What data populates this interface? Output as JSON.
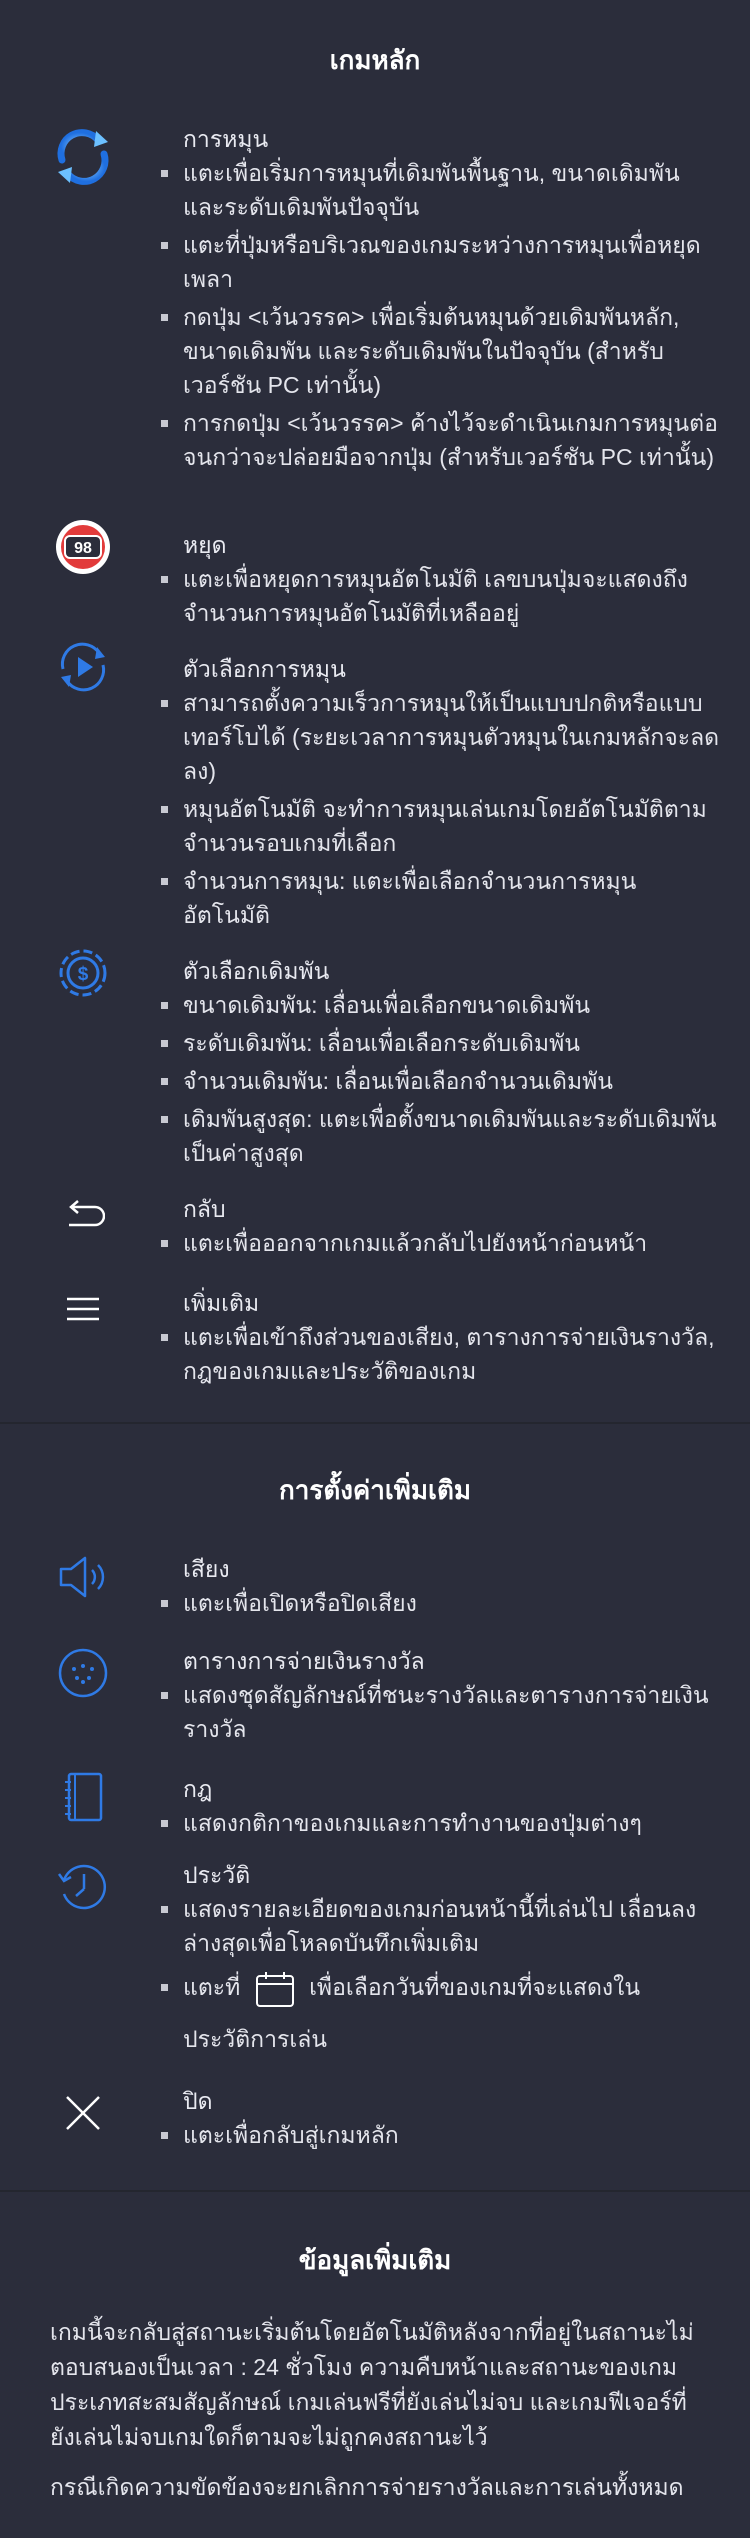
{
  "main_game": {
    "title": "เกมหลัก",
    "spin": {
      "icon": "spin-arrows-icon",
      "title": "การหมุน",
      "bullets": [
        "แตะเพื่อเริ่มการหมุนที่เดิมพันพื้นฐาน, ขนาดเดิมพันและระดับเดิมพันปัจจุบัน",
        "แตะที่ปุ่มหรือบริเวณของเกมระหว่างการหมุนเพื่อหยุดเพลา",
        "กดปุ่ม <เว้นวรรค> เพื่อเริ่มต้นหมุนด้วยเดิมพันหลัก, ขนาดเดิมพัน และระดับเดิมพันในปัจจุบัน (สำหรับเวอร์ชัน PC เท่านั้น)",
        "การกดปุ่ม <เว้นวรรค> ค้างไว้จะดำเนินเกมการหมุนต่อจนกว่าจะปล่อยมือจากปุ่ม (สำหรับเวอร์ชัน PC เท่านั้น)"
      ]
    },
    "stop": {
      "icon": "stop-counter-icon",
      "badge": "98",
      "title": "หยุด",
      "bullets": [
        "แตะเพื่อหยุดการหมุนอัตโนมัติ เลขบนปุ่มจะแสดงถึงจำนวนการหมุนอัตโนมัติที่เหลืออยู่"
      ]
    },
    "spin_options": {
      "icon": "spin-options-icon",
      "title": "ตัวเลือกการหมุน",
      "bullets": [
        "สามารถตั้งความเร็วการหมุนให้เป็นแบบปกติหรือแบบเทอร์โบได้ (ระยะเวลาการหมุนตัวหมุนในเกมหลักจะลดลง)",
        "หมุนอัตโนมัติ จะทำการหมุนเล่นเกมโดยอัตโนมัติตามจำนวนรอบเกมที่เลือก",
        "จำนวนการหมุน: แตะเพื่อเลือกจำนวนการหมุนอัตโนมัติ"
      ]
    },
    "bet_options": {
      "icon": "bet-coin-icon",
      "title": "ตัวเลือกเดิมพัน",
      "bullets": [
        "ขนาดเดิมพัน: เลื่อนเพื่อเลือกขนาดเดิมพัน",
        "ระดับเดิมพัน: เลื่อนเพื่อเลือกระดับเดิมพัน",
        "จำนวนเดิมพัน: เลื่อนเพื่อเลือกจำนวนเดิมพัน",
        "เดิมพันสูงสุด: แตะเพื่อตั้งขนาดเดิมพันและระดับเดิมพันเป็นค่าสูงสุด"
      ]
    },
    "back": {
      "icon": "back-arrow-icon",
      "title": "กลับ",
      "bullets": [
        "แตะเพื่อออกจากเกมแล้วกลับไปยังหน้าก่อนหน้า"
      ]
    },
    "more": {
      "icon": "menu-icon",
      "title": "เพิ่มเติม",
      "bullets": [
        "แตะเพื่อเข้าถึงส่วนของเสียง, ตารางการจ่ายเงินรางวัล, กฎของเกมและประวัติของเกม"
      ]
    }
  },
  "additional_settings": {
    "title": "การตั้งค่าเพิ่มเติม",
    "sound": {
      "icon": "speaker-icon",
      "title": "เสียง",
      "bullets": [
        "แตะเพื่อเปิดหรือปิดเสียง"
      ]
    },
    "paytable": {
      "icon": "paytable-icon",
      "title": "ตารางการจ่ายเงินรางวัล",
      "bullets": [
        "แสดงชุดสัญลักษณ์ที่ชนะรางวัลและตารางการจ่ายเงินรางวัล"
      ]
    },
    "rules": {
      "icon": "rulebook-icon",
      "title": "กฎ",
      "bullets": [
        "แสดงกติกาของเกมและการทำงานของปุ่มต่างๆ"
      ]
    },
    "history": {
      "icon": "history-clock-icon",
      "title": "ประวัติ",
      "bullets": [
        "แสดงรายละเอียดของเกมก่อนหน้านี้ที่เล่นไป เลื่อนลงล่างสุดเพื่อโหลดบันทึกเพิ่มเติม"
      ],
      "calendar_prefix": "แตะที่",
      "calendar_icon": "calendar-icon",
      "calendar_suffix": "เพื่อเลือกวันที่ของเกมที่จะแสดงใน",
      "calendar_line2": "ประวัติการเล่น"
    },
    "close": {
      "icon": "close-icon",
      "title": "ปิด",
      "bullets": [
        "แตะเพื่อกลับสู่เกมหลัก"
      ]
    }
  },
  "more_info": {
    "title": "ข้อมูลเพิ่มเติม",
    "paragraph1": "เกมนี้จะกลับสู่สถานะเริ่มต้นโดยอัตโนมัติหลังจากที่อยู่ในสถานะไม่ตอบสนองเป็นเวลา : 24 ชั่วโมง ความคืบหน้าและสถานะของเกมประเภทสะสมสัญลักษณ์ เกมเล่นฟรีที่ยังเล่นไม่จบ และเกมฟีเจอร์ที่ยังเล่นไม่จบเกมใดก็ตามจะไม่ถูกคงสถานะไว้",
    "paragraph2": "กรณีเกิดความขัดข้องจะยกเลิกการจ่ายรางวัลและการเล่นทั้งหมด"
  },
  "colors": {
    "background": "#2b2d3b",
    "accent_blue": "#2f7ae5",
    "stop_red": "#e23b3b",
    "text": "#e4e5ec"
  }
}
